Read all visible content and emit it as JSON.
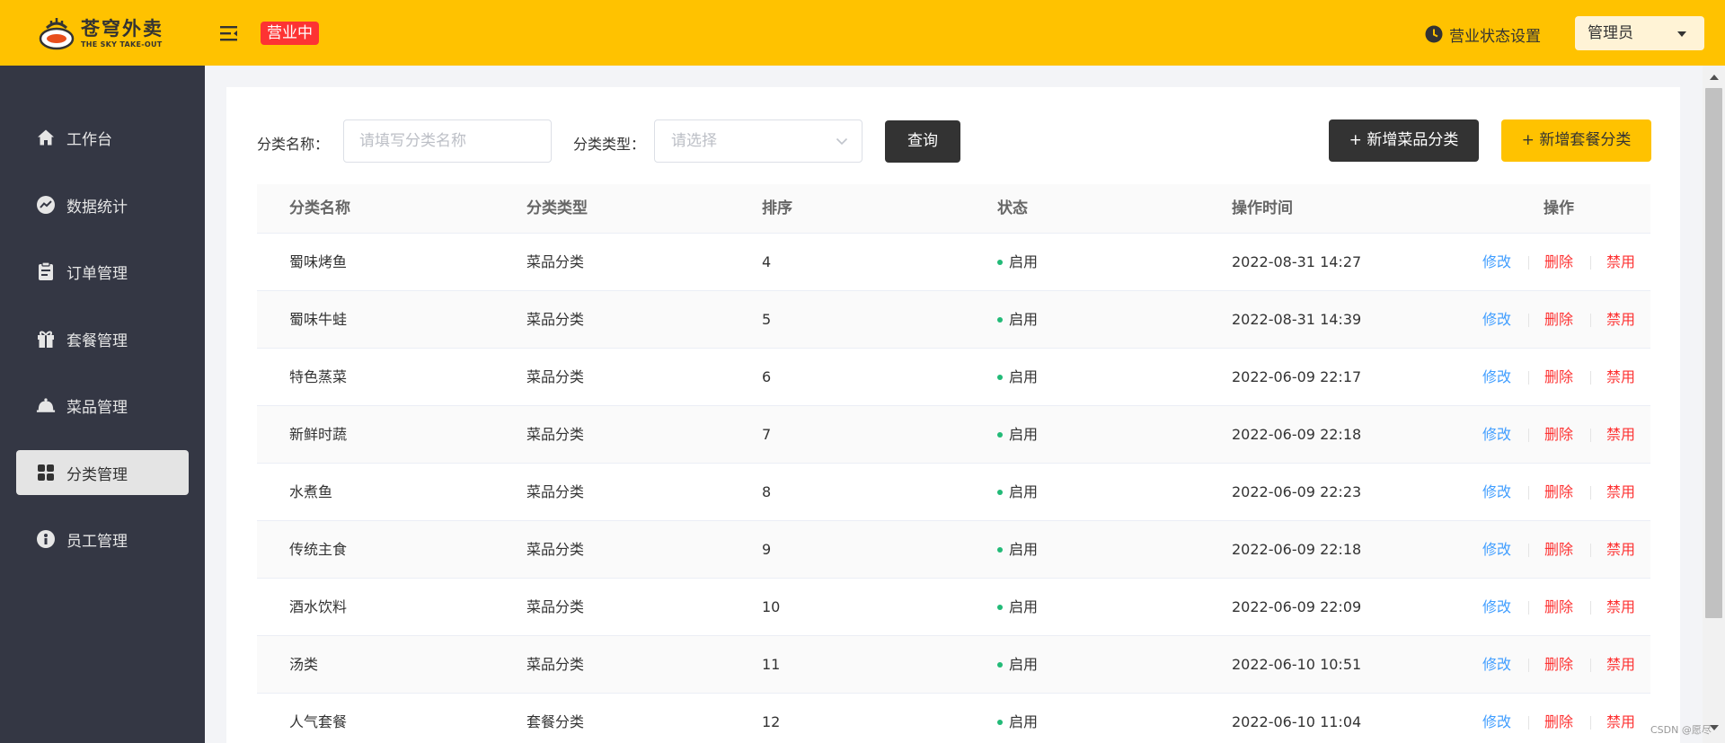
{
  "header": {
    "logo_cn": "苍穹外卖",
    "logo_en": "THE SKY TAKE-OUT",
    "open_status": "营业中",
    "status_setting_label": "营业状态设置",
    "user_name": "管理员"
  },
  "sidebar": {
    "items": [
      {
        "label": "工作台",
        "icon": "home-icon"
      },
      {
        "label": "数据统计",
        "icon": "chart-icon"
      },
      {
        "label": "订单管理",
        "icon": "clipboard-icon"
      },
      {
        "label": "套餐管理",
        "icon": "gift-icon"
      },
      {
        "label": "菜品管理",
        "icon": "dish-cover-icon"
      },
      {
        "label": "分类管理",
        "icon": "grid-icon",
        "active": true
      },
      {
        "label": "员工管理",
        "icon": "employee-icon"
      }
    ]
  },
  "filter": {
    "name_label": "分类名称：",
    "name_placeholder": "请填写分类名称",
    "type_label": "分类类型：",
    "type_placeholder": "请选择",
    "query_label": "查询",
    "add_dish_category_label": "+ 新增菜品分类",
    "add_combo_category_label": "+ 新增套餐分类"
  },
  "table": {
    "columns": [
      "分类名称",
      "分类类型",
      "排序",
      "状态",
      "操作时间",
      "操作"
    ],
    "actions": {
      "edit": "修改",
      "delete": "删除",
      "disable": "禁用"
    },
    "rows": [
      {
        "name": "蜀味烤鱼",
        "type": "菜品分类",
        "sort": "4",
        "status": "启用",
        "time": "2022-08-31 14:27"
      },
      {
        "name": "蜀味牛蛙",
        "type": "菜品分类",
        "sort": "5",
        "status": "启用",
        "time": "2022-08-31 14:39"
      },
      {
        "name": "特色蒸菜",
        "type": "菜品分类",
        "sort": "6",
        "status": "启用",
        "time": "2022-06-09 22:17"
      },
      {
        "name": "新鲜时蔬",
        "type": "菜品分类",
        "sort": "7",
        "status": "启用",
        "time": "2022-06-09 22:18"
      },
      {
        "name": "水煮鱼",
        "type": "菜品分类",
        "sort": "8",
        "status": "启用",
        "time": "2022-06-09 22:23"
      },
      {
        "name": "传统主食",
        "type": "菜品分类",
        "sort": "9",
        "status": "启用",
        "time": "2022-06-09 22:18"
      },
      {
        "name": "酒水饮料",
        "type": "菜品分类",
        "sort": "10",
        "status": "启用",
        "time": "2022-06-09 22:09"
      },
      {
        "name": "汤类",
        "type": "菜品分类",
        "sort": "11",
        "status": "启用",
        "time": "2022-06-10 10:51"
      },
      {
        "name": "人气套餐",
        "type": "套餐分类",
        "sort": "12",
        "status": "启用",
        "time": "2022-06-10 11:04"
      }
    ]
  },
  "watermark": "CSDN @愿尽",
  "colors": {
    "brand": "#ffc200",
    "sidebar": "#343744",
    "edit": "#419eff",
    "danger": "#fd3333",
    "enabled": "#22ba77"
  }
}
